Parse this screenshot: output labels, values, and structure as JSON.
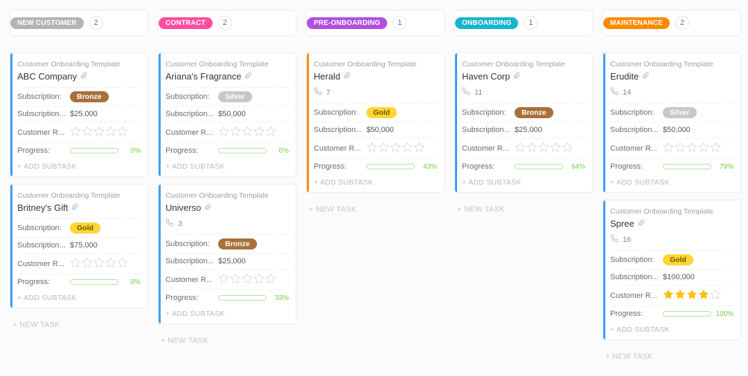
{
  "labels": {
    "template": "Customer Onboarding Template",
    "subscription": "Subscription:",
    "subscription_amt": "Subscription...",
    "customer_r": "Customer R...",
    "progress": "Progress:",
    "add_subtask": "+ ADD SUBTASK",
    "new_task": "+ NEW TASK"
  },
  "columns": [
    {
      "id": "new-customer",
      "label": "NEW CUSTOMER",
      "count": 2,
      "color": "gray",
      "cards": [
        {
          "title": "ABC Company",
          "tier": "Bronze",
          "amount": "$25,000",
          "rating": 0,
          "progress": 0,
          "stripe": "blue"
        },
        {
          "title": "Britney's Gift",
          "tier": "Gold",
          "amount": "$75,000",
          "rating": 0,
          "progress": 0,
          "stripe": "blue"
        }
      ]
    },
    {
      "id": "contract",
      "label": "CONTRACT",
      "count": 2,
      "color": "pink",
      "cards": [
        {
          "title": "Ariana's Fragrance",
          "tier": "Silver",
          "amount": "$50,000",
          "rating": 0,
          "progress": 0,
          "stripe": "blue"
        },
        {
          "title": "Universo",
          "phone": "3",
          "tier": "Bronze",
          "amount": "$25,000",
          "rating": 0,
          "progress": 33,
          "stripe": "blue"
        }
      ]
    },
    {
      "id": "pre-onboarding",
      "label": "PRE-ONBOARDING",
      "count": 1,
      "color": "purple",
      "cards": [
        {
          "title": "Herald",
          "phone": "7",
          "tier": "Gold",
          "amount": "$50,000",
          "rating": 0,
          "progress": 43,
          "stripe": "orange"
        }
      ]
    },
    {
      "id": "onboarding",
      "label": "ONBOARDING",
      "count": 1,
      "color": "teal",
      "cards": [
        {
          "title": "Haven Corp",
          "phone": "11",
          "tier": "Bronze",
          "amount": "$25,000",
          "rating": 0,
          "progress": 64,
          "stripe": "blue"
        }
      ]
    },
    {
      "id": "maintenance",
      "label": "MAINTENANCE",
      "count": 2,
      "color": "orange",
      "cards": [
        {
          "title": "Erudite",
          "phone": "14",
          "tier": "Silver",
          "amount": "$50,000",
          "rating": 0,
          "progress": 79,
          "stripe": "blue"
        },
        {
          "title": "Spree",
          "phone": "16",
          "tier": "Gold",
          "amount": "$100,000",
          "rating": 4,
          "progress": 100,
          "stripe": "blue"
        }
      ]
    }
  ]
}
